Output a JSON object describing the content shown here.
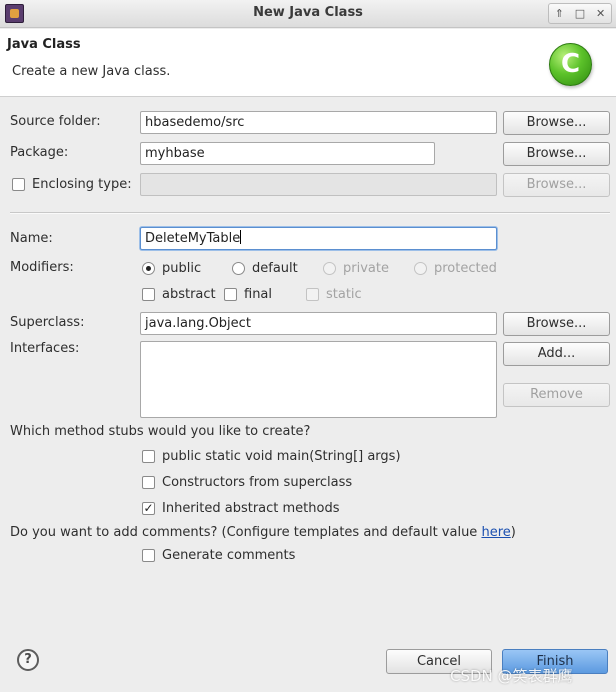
{
  "window": {
    "title": "New Java Class",
    "controls": {
      "up": "⇑",
      "restore": "□",
      "close": "✕"
    }
  },
  "banner": {
    "title": "Java Class",
    "description": "Create a new Java class.",
    "logo_glyph": "C",
    "logo_color": "#5cc22a"
  },
  "form": {
    "source_folder": {
      "label": "Source folder:",
      "value": "hbasedemo/src",
      "button": "Browse..."
    },
    "package": {
      "label": "Package:",
      "value": "myhbase",
      "button": "Browse..."
    },
    "enclosing_type": {
      "label": "Enclosing type:",
      "value": "",
      "checked": false,
      "button": "Browse..."
    },
    "name": {
      "label": "Name:",
      "value": "DeleteMyTable"
    },
    "modifiers": {
      "label": "Modifiers:",
      "access": [
        {
          "label": "public",
          "checked": true,
          "enabled": true
        },
        {
          "label": "default",
          "checked": false,
          "enabled": true
        },
        {
          "label": "private",
          "checked": false,
          "enabled": false
        },
        {
          "label": "protected",
          "checked": false,
          "enabled": false
        }
      ],
      "flags": [
        {
          "label": "abstract",
          "checked": false,
          "enabled": true
        },
        {
          "label": "final",
          "checked": false,
          "enabled": true
        },
        {
          "label": "static",
          "checked": false,
          "enabled": false
        }
      ]
    },
    "superclass": {
      "label": "Superclass:",
      "value": "java.lang.Object",
      "button": "Browse..."
    },
    "interfaces": {
      "label": "Interfaces:",
      "add_button": "Add...",
      "remove_button": "Remove"
    },
    "stubs": {
      "question": "Which method stubs would you like to create?",
      "options": [
        {
          "label": "public static void main(String[] args)",
          "checked": false
        },
        {
          "label": "Constructors from superclass",
          "checked": false
        },
        {
          "label": "Inherited abstract methods",
          "checked": true
        }
      ]
    },
    "comments": {
      "question": "Do you want to add comments? (Configure templates and default value ",
      "link": "here",
      "question_end": ")",
      "option": {
        "label": "Generate comments",
        "checked": false
      }
    }
  },
  "footer": {
    "help": "?",
    "cancel": "Cancel",
    "finish": "Finish",
    "watermark": "CSDN @笑表群鹰"
  },
  "colors": {
    "link": "#1a4fb0",
    "finish_button": "#5c9ae0",
    "focus_border": "#5b8fd0"
  }
}
